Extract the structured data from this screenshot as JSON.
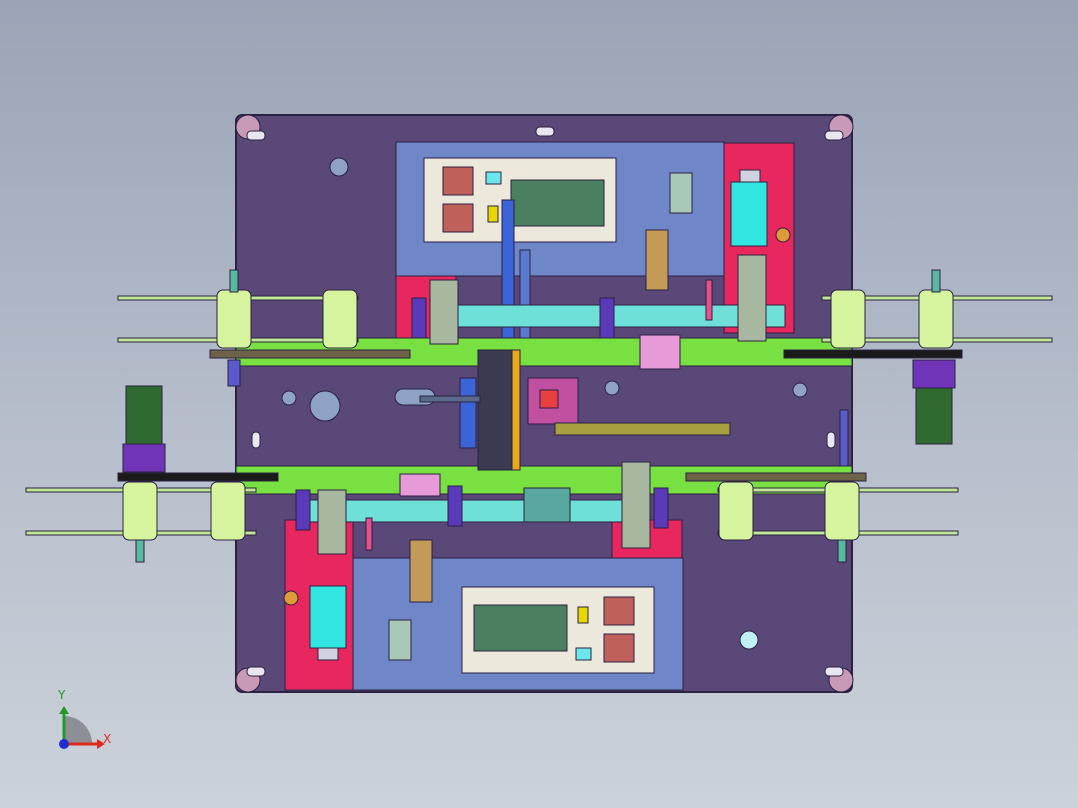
{
  "triad": {
    "x_label": "X",
    "y_label": "Y",
    "x_color": "#e0281e",
    "y_color": "#1f9a2a",
    "z_color": "#1e2fd0"
  },
  "colors": {
    "plate": "#5a4878",
    "plate_edge": "#2b2140",
    "panel_blue": "#6f86c8",
    "panel_red": "#e9275f",
    "display": "#4a8060",
    "button": "#c0605a",
    "lime": "#b6e26a",
    "cyan": "#31e6e0",
    "purple": "#7034b8",
    "dark_green": "#2f6a30",
    "green_bar": "#76e040"
  },
  "components": [
    "base-plate",
    "control-panel-top",
    "control-panel-bottom",
    "spool-left-upper",
    "spool-left-lower",
    "spool-right-upper",
    "spool-right-lower",
    "motor-left",
    "motor-right",
    "center-mechanism"
  ]
}
